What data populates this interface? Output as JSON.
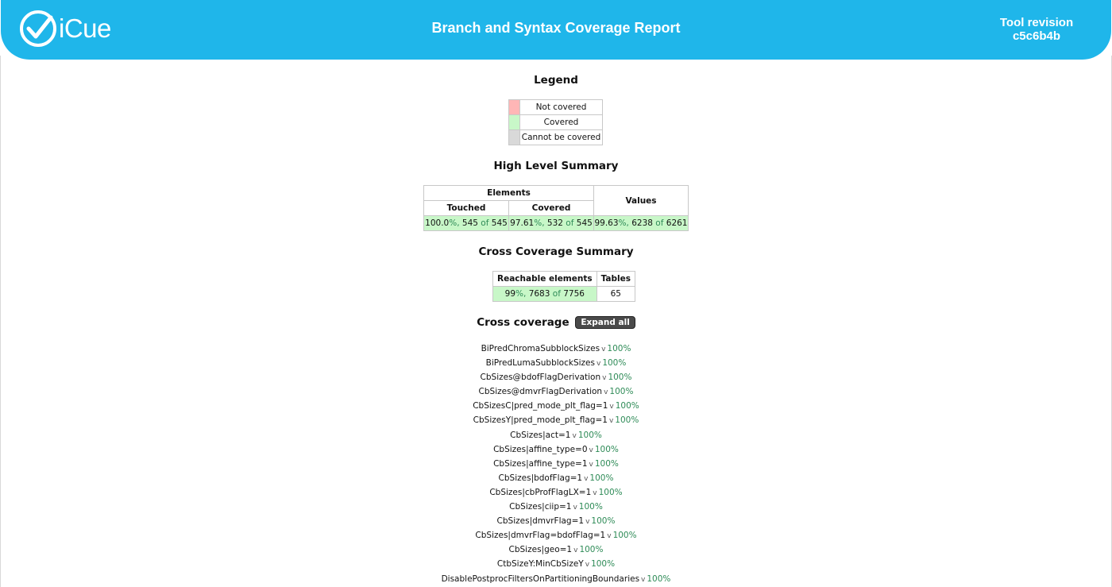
{
  "header": {
    "logo_text": "iCue",
    "title": "Branch and Syntax Coverage Report",
    "revision_label": "Tool revision",
    "revision_value": "c5c6b4b"
  },
  "legend": {
    "title": "Legend",
    "items": [
      {
        "label": "Not covered",
        "color": "#ffb6b6"
      },
      {
        "label": "Covered",
        "color": "#c8f7c8"
      },
      {
        "label": "Cannot be covered",
        "color": "#d9d9d9"
      }
    ]
  },
  "high_level": {
    "title": "High Level Summary",
    "elements_header": "Elements",
    "touched_header": "Touched",
    "covered_header": "Covered",
    "values_header": "Values",
    "touched": {
      "pct": "100.0",
      "num": "545",
      "den": "545"
    },
    "covered": {
      "pct": "97.61",
      "num": "532",
      "den": "545"
    },
    "values": {
      "pct": "99.63",
      "num": "6238",
      "den": "6261"
    },
    "of_word": "of",
    "pct_sign": "%,"
  },
  "cross_summary": {
    "title": "Cross Coverage Summary",
    "reachable_header": "Reachable elements",
    "tables_header": "Tables",
    "reachable": {
      "pct": "99",
      "num": "7683",
      "den": "7756"
    },
    "tables": "65"
  },
  "cross_coverage": {
    "title": "Cross coverage",
    "expand_label": "Expand all",
    "chevron": "v",
    "items": [
      {
        "name": "BiPredChromaSubblockSizes",
        "pct": "100%"
      },
      {
        "name": "BiPredLumaSubblockSizes",
        "pct": "100%"
      },
      {
        "name": "CbSizes@bdofFlagDerivation",
        "pct": "100%"
      },
      {
        "name": "CbSizes@dmvrFlagDerivation",
        "pct": "100%"
      },
      {
        "name": "CbSizesC|pred_mode_plt_flag=1",
        "pct": "100%"
      },
      {
        "name": "CbSizesY|pred_mode_plt_flag=1",
        "pct": "100%"
      },
      {
        "name": "CbSizes|act=1",
        "pct": "100%"
      },
      {
        "name": "CbSizes|affine_type=0",
        "pct": "100%"
      },
      {
        "name": "CbSizes|affine_type=1",
        "pct": "100%"
      },
      {
        "name": "CbSizes|bdofFlag=1",
        "pct": "100%"
      },
      {
        "name": "CbSizes|cbProfFlagLX=1",
        "pct": "100%"
      },
      {
        "name": "CbSizes|ciip=1",
        "pct": "100%"
      },
      {
        "name": "CbSizes|dmvrFlag=1",
        "pct": "100%"
      },
      {
        "name": "CbSizes|dmvrFlag=bdofFlag=1",
        "pct": "100%"
      },
      {
        "name": "CbSizes|geo=1",
        "pct": "100%"
      },
      {
        "name": "CtbSizeY:MinCbSizeY",
        "pct": "100%"
      },
      {
        "name": "DisablePostprocFiltersOnPartitioningBoundaries",
        "pct": "100%"
      }
    ]
  }
}
